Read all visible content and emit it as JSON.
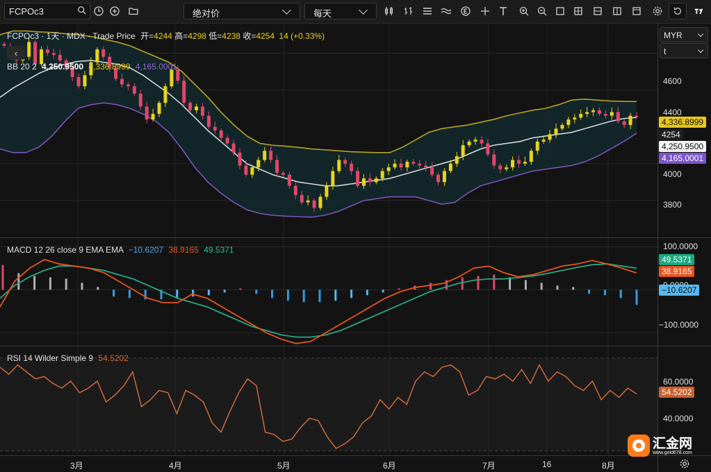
{
  "toolbar": {
    "symbol": "FCPOc3",
    "scale_mode": "绝对价",
    "interval": "每天"
  },
  "header": {
    "symbol": "FCPOc3",
    "sep1": "·",
    "interval": "1天",
    "sep2": "·",
    "exchange": "MDX",
    "sep3": "·",
    "price_type": "Trade Price",
    "open_label": "开=",
    "open": "4244",
    "high_label": "高=",
    "high": "4298",
    "low_label": "低=",
    "low": "4238",
    "close_label": "收=",
    "close": "4254",
    "change": "14 (+0.33%)"
  },
  "currency": {
    "value": "MYR",
    "unit": "t"
  },
  "bb": {
    "label": "BB 20 2",
    "middle": "4,250.9500",
    "upper": "4,336.8999",
    "lower": "4,165.0001"
  },
  "macd": {
    "label": "MACD 12 26 close 9 EMA EMA",
    "hist": "−10.6207",
    "macd": "38.9165",
    "signal": "49.5371"
  },
  "rsi": {
    "label": "RSI 14 Wilder Simple 9",
    "value": "54.5202"
  },
  "price_axis": {
    "ticks": [
      "4600",
      "4400",
      "4000",
      "3800"
    ]
  },
  "macd_axis": {
    "ticks": [
      "100.0000",
      "0.0000",
      "−100.0000"
    ]
  },
  "rsi_axis": {
    "ticks": [
      "60.0000",
      "40.0000"
    ]
  },
  "tags": {
    "bb_upper": "4,336.8999",
    "last_price": "4254",
    "bb_middle": "4,250.9500",
    "bb_lower": "4,165.0001",
    "macd_signal": "49.5371",
    "macd_line": "38.9165",
    "macd_hist": "−10.6207",
    "rsi": "54.5202"
  },
  "x_axis": {
    "labels": [
      "3月",
      "4月",
      "5月",
      "6月",
      "7月",
      "16",
      "8月"
    ]
  },
  "watermark": {
    "text": "汇金网",
    "url": "www.gold678.com"
  },
  "colors": {
    "up": "#e8d31f",
    "down": "#e0476a",
    "bb_upper": "#b8a32a",
    "bb_middle": "#d5dad8",
    "bb_lower": "#7a55b8",
    "bb_fill": "#13292d",
    "macd_line": "#e8541e",
    "signal_line": "#2aa886",
    "rsi_line": "#d06a3c"
  },
  "chart_data": {
    "type": "candlestick",
    "x_labels": [
      "3月",
      "4月",
      "5月",
      "6月",
      "7月",
      "16",
      "8月"
    ],
    "price": {
      "last": {
        "open": 4244,
        "high": 4298,
        "low": 4238,
        "close": 4254,
        "change": 14,
        "change_pct": 0.33
      },
      "close_series": [
        4640,
        4610,
        4560,
        4580,
        4660,
        4540,
        4620,
        4600,
        4590,
        4560,
        4520,
        4470,
        4420,
        4480,
        4550,
        4620,
        4580,
        4520,
        4460,
        4430,
        4420,
        4380,
        4310,
        4240,
        4270,
        4330,
        4420,
        4510,
        4450,
        4330,
        4290,
        4310,
        4260,
        4200,
        4180,
        4140,
        4110,
        4060,
        3990,
        3940,
        3980,
        4020,
        4070,
        4020,
        3950,
        3940,
        3880,
        3830,
        3790,
        3800,
        3760,
        3820,
        3880,
        3960,
        4020,
        4000,
        3960,
        3880,
        3920,
        3900,
        3920,
        3960,
        3980,
        4000,
        3980,
        4010,
        4000,
        3990,
        3980,
        3940,
        3900,
        3960,
        4000,
        4040,
        4100,
        4120,
        4130,
        4110,
        4050,
        3990,
        3970,
        3980,
        4020,
        4000,
        4010,
        4070,
        4120,
        4130,
        4160,
        4190,
        4210,
        4240,
        4250,
        4270,
        4280,
        4290,
        4270,
        4260,
        4280,
        4230,
        4210,
        4260,
        4254
      ],
      "bb_upper_series": [
        4700,
        4720,
        4720,
        4715,
        4712,
        4705,
        4700,
        4690,
        4675,
        4660,
        4640,
        4610,
        4580,
        4550,
        4500,
        4430,
        4360,
        4280,
        4210,
        4150,
        4110,
        4100,
        4095,
        4088,
        4080,
        4075,
        4070,
        4065,
        4062,
        4060,
        4060,
        4090,
        4130,
        4170,
        4190,
        4200,
        4210,
        4225,
        4240,
        4260,
        4275,
        4290,
        4300,
        4320,
        4345,
        4350,
        4345,
        4340,
        4338,
        4337
      ],
      "bb_middle_series": [
        4360,
        4410,
        4450,
        4490,
        4520,
        4540,
        4555,
        4560,
        4550,
        4540,
        4520,
        4480,
        4430,
        4380,
        4320,
        4250,
        4180,
        4120,
        4060,
        4000,
        3970,
        3940,
        3920,
        3900,
        3890,
        3880,
        3880,
        3890,
        3900,
        3910,
        3920,
        3940,
        3960,
        3980,
        4000,
        4020,
        4050,
        4080,
        4100,
        4110,
        4120,
        4140,
        4150,
        4160,
        4170,
        4190,
        4210,
        4230,
        4245,
        4251
      ],
      "bb_lower_series": [
        4080,
        4060,
        4060,
        4090,
        4150,
        4230,
        4300,
        4320,
        4330,
        4320,
        4300,
        4270,
        4230,
        4170,
        4080,
        3980,
        3900,
        3840,
        3790,
        3750,
        3730,
        3720,
        3715,
        3712,
        3710,
        3720,
        3740,
        3770,
        3800,
        3810,
        3820,
        3820,
        3820,
        3800,
        3780,
        3790,
        3840,
        3880,
        3900,
        3920,
        3940,
        3960,
        3970,
        3980,
        3990,
        4010,
        4040,
        4080,
        4120,
        4165
      ],
      "ylim": [
        3600,
        4760
      ]
    },
    "macd": {
      "macd_line_last": 38.9165,
      "signal_last": 49.5371,
      "hist_last": -10.6207,
      "macd_series": [
        -40,
        20,
        50,
        70,
        60,
        55,
        50,
        40,
        20,
        0,
        -20,
        -30,
        -30,
        -10,
        -20,
        -40,
        -60,
        -80,
        -100,
        -115,
        -125,
        -120,
        -100,
        -80,
        -60,
        -40,
        -20,
        -5,
        5,
        10,
        15,
        30,
        50,
        55,
        40,
        30,
        35,
        45,
        55,
        60,
        68,
        60,
        50,
        39
      ],
      "signal_series": [
        -20,
        10,
        30,
        45,
        55,
        55,
        50,
        45,
        35,
        25,
        10,
        -5,
        -20,
        -30,
        -40,
        -55,
        -70,
        -85,
        -95,
        -105,
        -110,
        -110,
        -105,
        -95,
        -80,
        -65,
        -50,
        -35,
        -20,
        -5,
        5,
        15,
        22,
        25,
        25,
        28,
        32,
        38,
        45,
        52,
        58,
        60,
        55,
        50
      ],
      "hist_series": [
        18,
        12,
        10,
        9,
        8,
        5,
        2,
        -5,
        -6,
        -7,
        -7,
        -6,
        -5,
        -4,
        -2,
        1,
        -3,
        -6,
        -8,
        -9,
        -9,
        -8,
        -6,
        -4,
        -2,
        1,
        3,
        5,
        7,
        9,
        10,
        11,
        9,
        7,
        5,
        3,
        2,
        -3,
        -4,
        -6,
        -11
      ],
      "ylim": [
        -130,
        120
      ]
    },
    "rsi": {
      "last": 54.5202,
      "series": [
        66,
        63,
        67,
        64,
        61,
        62,
        59,
        57,
        60,
        55,
        57,
        60,
        51,
        54,
        58,
        64,
        49,
        52,
        56,
        55,
        46,
        56,
        54,
        51,
        42,
        38,
        47,
        55,
        61,
        58,
        38,
        37,
        34,
        35,
        40,
        44,
        43,
        36,
        31,
        33,
        36,
        42,
        45,
        52,
        48,
        53,
        50,
        60,
        64,
        62,
        66,
        67,
        64,
        54,
        56,
        62,
        61,
        63,
        60,
        65,
        59,
        67,
        60,
        64,
        62,
        58,
        56,
        60,
        52,
        56,
        53,
        57,
        54.5
      ],
      "ylim": [
        28,
        75
      ]
    }
  }
}
